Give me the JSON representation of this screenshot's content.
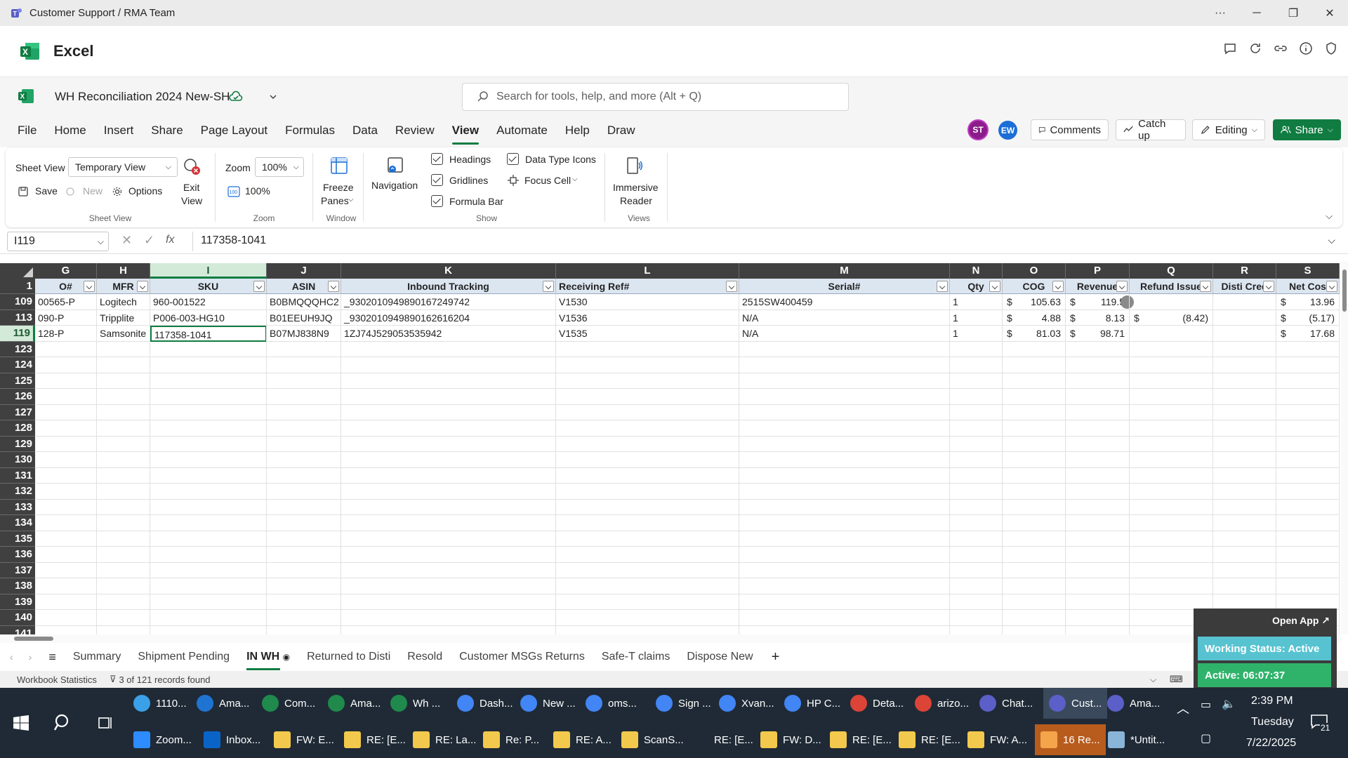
{
  "window": {
    "title": "Customer Support / RMA Team",
    "more": "···"
  },
  "app": {
    "name": "Excel"
  },
  "doc": {
    "name": "WH Reconciliation 2024 New-SH"
  },
  "search": {
    "placeholder": "Search for tools, help, and more (Alt + Q)"
  },
  "menu": {
    "tabs": [
      "File",
      "Home",
      "Insert",
      "Share",
      "Page Layout",
      "Formulas",
      "Data",
      "Review",
      "View",
      "Automate",
      "Help",
      "Draw"
    ],
    "active": "View"
  },
  "users": [
    {
      "initials": "ST",
      "color": "#8b1d8b"
    },
    {
      "initials": "EW",
      "color": "#1b6ed6"
    }
  ],
  "header_buttons": {
    "comments": "Comments",
    "catchup": "Catch up",
    "editing": "Editing",
    "share": "Share"
  },
  "ribbon": {
    "sheet_view_label": "Sheet View",
    "sheet_view_value": "Temporary View",
    "save": "Save",
    "new": "New",
    "options": "Options",
    "exit_view_1": "Exit",
    "exit_view_2": "View",
    "group_sheet_view": "Sheet View",
    "zoom_label": "Zoom",
    "zoom_value": "100%",
    "zoom_100": "100%",
    "group_zoom": "Zoom",
    "freeze_1": "Freeze",
    "freeze_2": "Panes",
    "group_window": "Window",
    "navigation": "Navigation",
    "headings": "Headings",
    "gridlines": "Gridlines",
    "formula_bar": "Formula Bar",
    "data_type_icons": "Data Type Icons",
    "focus_cell": "Focus Cell",
    "group_show": "Show",
    "immersive_1": "Immersive",
    "immersive_2": "Reader",
    "group_views": "Views"
  },
  "formula_bar": {
    "name_box": "I119",
    "fx": "fx",
    "value": "117358-1041"
  },
  "grid": {
    "columns": [
      "G",
      "H",
      "I",
      "J",
      "K",
      "L",
      "M",
      "N",
      "O",
      "P",
      "Q",
      "R",
      "S"
    ],
    "selected_col": "I",
    "headers": [
      "O#",
      "MFR",
      "SKU",
      "ASIN",
      "Inbound Tracking",
      "Receiving Ref#",
      "Serial#",
      "Qty",
      "COG",
      "Revenue",
      "Refund Issue",
      "Disti Cred",
      "Net Cos"
    ],
    "rows": [
      {
        "num": "109",
        "cells": [
          "00565-P",
          "Logitech",
          "960-001522",
          "B0BMQQQHC2",
          "_930201094989016724974​2",
          "V1530",
          "2515SW400459",
          "1",
          "$",
          "105.63",
          "$",
          "119.5",
          "",
          "",
          "$",
          "13.96"
        ]
      },
      {
        "num": "113",
        "cells": [
          "090-P",
          "Tripplite",
          "P006-003-HG10",
          "B01EEUH9JQ",
          "_930201094989016261620​4",
          "V1536",
          "N/A",
          "1",
          "$",
          "4.88",
          "$",
          "8.13",
          "$",
          "(8.42)",
          "$",
          "(5.17)"
        ]
      },
      {
        "num": "119",
        "cells": [
          "128-P",
          "Samsonite",
          "117358-1041",
          "B07MJ838N9",
          "1ZJ74J529053535942",
          "V1535",
          "N/A",
          "1",
          "$",
          "81.03",
          "$",
          "98.71",
          "",
          "",
          "$",
          "17.68"
        ]
      }
    ],
    "empty_rows": [
      "123",
      "124",
      "125",
      "126",
      "127",
      "128",
      "129",
      "130",
      "131",
      "132",
      "133",
      "134",
      "135",
      "136",
      "137",
      "138",
      "139",
      "140",
      "141"
    ],
    "header_row": "1"
  },
  "sheets": {
    "tabs": [
      "Summary",
      "Shipment Pending",
      "IN WH",
      "Returned to Disti",
      "Resold",
      "Customer MSGs Returns",
      "Safe-T claims",
      "Dispose New"
    ],
    "active": "IN WH"
  },
  "status": {
    "workbook_stats": "Workbook Statistics",
    "records": "3 of 121 records found",
    "zoom": "100%"
  },
  "widget": {
    "open_app": "Open App ↗",
    "status": "Working Status: Active",
    "active": "Active: 06:07:37"
  },
  "taskbar": {
    "row1": [
      "1110...",
      "Ama...",
      "Com...",
      "Ama...",
      "Wh ...",
      "Dash...",
      "New ...",
      "oms...",
      "Sign ...",
      "Xvan...",
      "HP C...",
      "Deta...",
      "arizo...",
      "Chat...",
      "Cust...",
      "Ama..."
    ],
    "row2": [
      "Zoom...",
      "Inbox...",
      "FW: E...",
      "RE: [E...",
      "RE: La...",
      "Re: P...",
      "RE: A...",
      "ScanS...",
      "RE: [E...",
      "FW: D...",
      "RE: [E...",
      "RE: [E...",
      "FW: A...",
      "16 Re...",
      "*Untit..."
    ],
    "time": "2:39 PM",
    "day": "Tuesday",
    "date": "7/22/2025",
    "notif": "21"
  },
  "colors": {
    "excel_green": "#107c41",
    "header_dark": "#404040",
    "filter_header": "#dce6f1",
    "taskbar": "#1f2a36"
  }
}
